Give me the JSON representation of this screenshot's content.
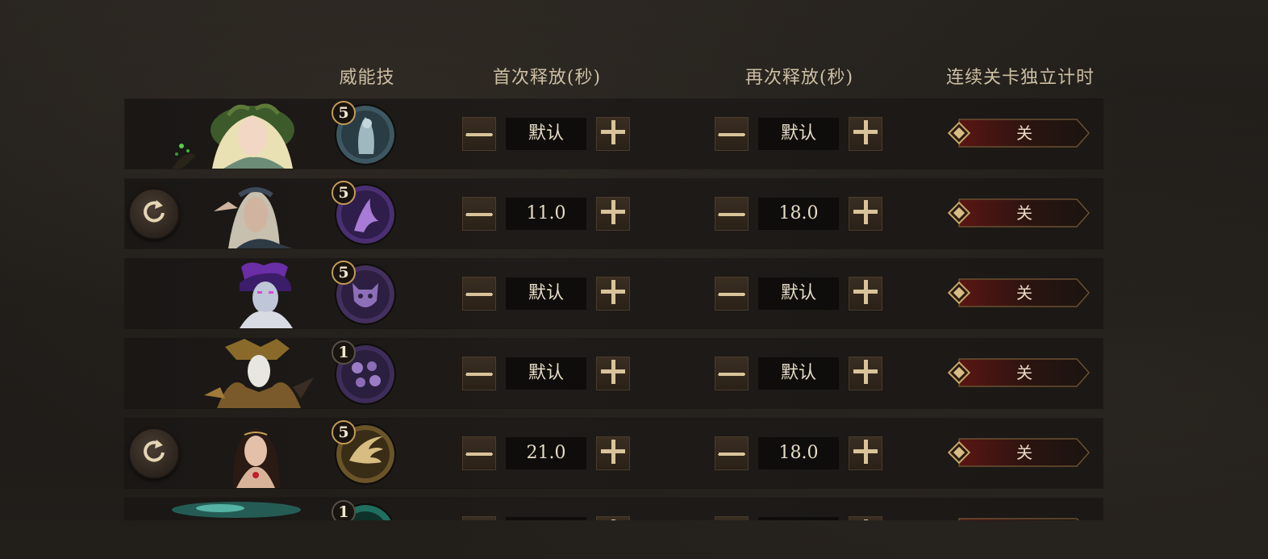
{
  "headers": {
    "skill": "威能技",
    "first_release": "首次释放(秒)",
    "second_release": "再次释放(秒)",
    "stage_timer": "连续关卡独立计时"
  },
  "rows": [
    {
      "hero": "forest-elf-portrait",
      "skill_icon": "ghost-figure-skill-icon",
      "skill_level": "5",
      "first_value": "默认",
      "second_value": "默认",
      "toggle": "关",
      "has_reset": false
    },
    {
      "hero": "dark-elf-portrait",
      "skill_icon": "purple-claw-skill-icon",
      "skill_level": "5",
      "first_value": "11.0",
      "second_value": "18.0",
      "toggle": "关",
      "has_reset": true
    },
    {
      "hero": "purple-demon-portrait",
      "skill_icon": "demon-face-skill-icon",
      "skill_level": "5",
      "first_value": "默认",
      "second_value": "默认",
      "toggle": "关",
      "has_reset": false
    },
    {
      "hero": "masked-golden-portrait",
      "skill_icon": "skull-swarm-skill-icon",
      "skill_level": "1",
      "first_value": "默认",
      "second_value": "默认",
      "toggle": "关",
      "has_reset": false
    },
    {
      "hero": "dark-haired-woman-portrait",
      "skill_icon": "golden-wing-skill-icon",
      "skill_level": "5",
      "first_value": "21.0",
      "second_value": "18.0",
      "toggle": "关",
      "has_reset": true
    },
    {
      "hero": "teal-glow-portrait",
      "skill_icon": "teal-ring-skill-icon",
      "skill_level": "1",
      "first_value": "",
      "second_value": "",
      "toggle": "",
      "has_reset": false
    }
  ],
  "colors": {
    "header_text": "#cdbfa3",
    "row_bg": "#1c1916",
    "button_gold": "#d9c49a",
    "toggle_red": "#5a1612",
    "badge_ring": "#c49a58"
  }
}
